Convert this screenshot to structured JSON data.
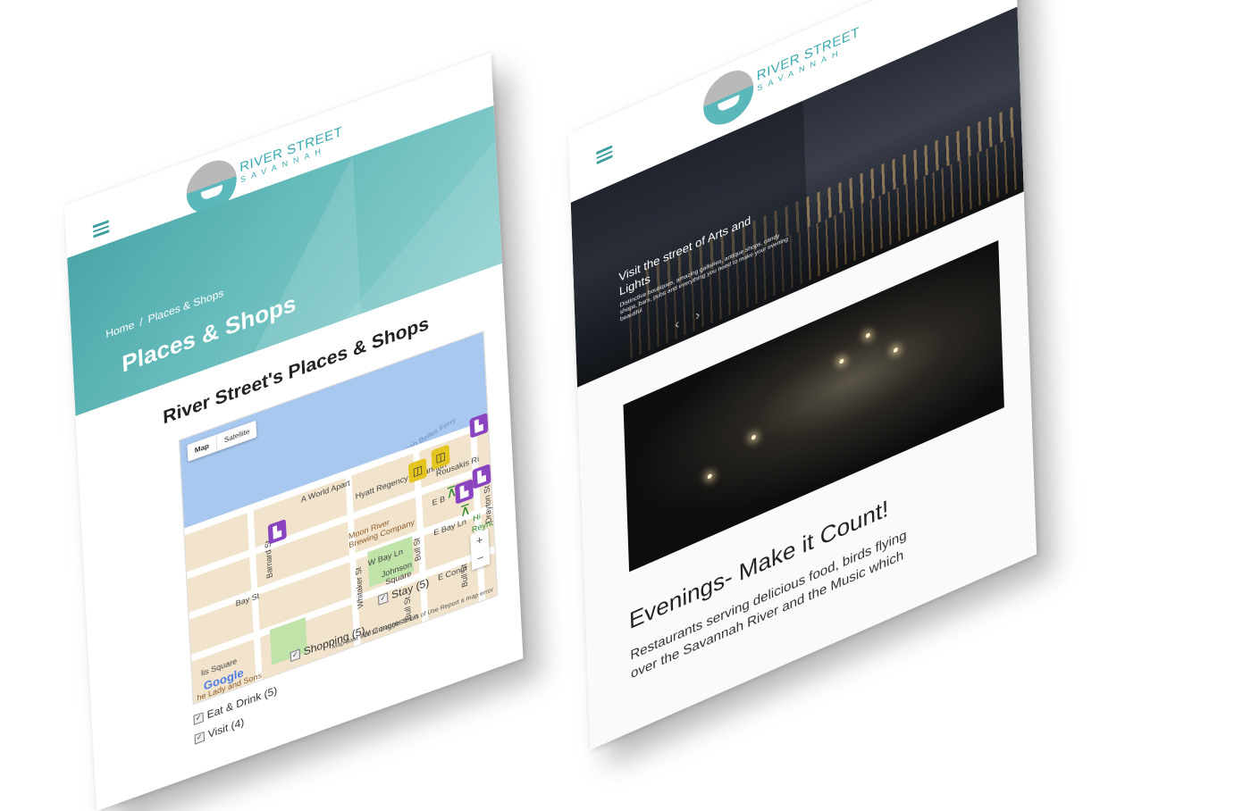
{
  "left": {
    "logo": {
      "line1": "RIVER STREET",
      "line2": "SAVANNAH"
    },
    "breadcrumb": {
      "home": "Home",
      "separator": "/",
      "current": "Places & Shops"
    },
    "hero_title": "Places & Shops",
    "section_title": "River Street's Places & Shops",
    "map": {
      "type_map": "Map",
      "type_satellite": "Satellite",
      "ferry": "Savannah Belles Ferry",
      "labels": {
        "world_apart": "A World Apart",
        "hyatt": "Hyatt Regency Savannah",
        "rousakis": "Rousakis Ri",
        "moon_river": "Moon River",
        "brewing": "Brewing Company",
        "bay_st": "Bay St",
        "e_bay_st": "E B",
        "e_bay_ln": "E Bay Ln",
        "w_bay_ln": "W Bay Ln",
        "barnard": "Barnard St",
        "whitaker": "Whitaker St",
        "bull1": "Bull St",
        "bull2": "Bull St",
        "bull3": "Bull St",
        "drayton": "Drayton St",
        "johnson1": "Johnson",
        "johnson2": "Square",
        "ellis": "lis Square",
        "lady": "he Lady and Sons",
        "congress": "W Congress Ln",
        "congress_e": "E Congr",
        "hi": "Hi",
        "rey": "Reyno",
        "f": "F"
      },
      "zoom_in": "+",
      "zoom_out": "−",
      "google": "Google",
      "attrib_data": "Map data ©2016 Google",
      "attrib_terms": "Terms of Use",
      "attrib_report": "Report a map error"
    },
    "filters": [
      {
        "label": "Eat & Drink (5)"
      },
      {
        "label": "Shopping (5)"
      },
      {
        "label": "Stay (5)"
      },
      {
        "label": "Visit (4)"
      }
    ]
  },
  "right": {
    "logo": {
      "line1": "RIVER STREET",
      "line2": "SAVANNAH"
    },
    "slide": {
      "title": "Visit the street of Arts and Lights",
      "text": "Distinctive boutiques, amazing galleries, antique shops, candy shops, bars, pubs and everything you need to make your evening beautiful",
      "prev": "‹",
      "next": "›"
    },
    "headline": "Evenings- Make it Count!",
    "body": "Restaurants serving delicious food, birds flying over the Savannah River and the Music which"
  },
  "colors": {
    "accent": "#3aaab0",
    "hero": "#5bb5b6",
    "poi_purple": "#8a44c0",
    "poi_yellow": "#e4c41e"
  }
}
